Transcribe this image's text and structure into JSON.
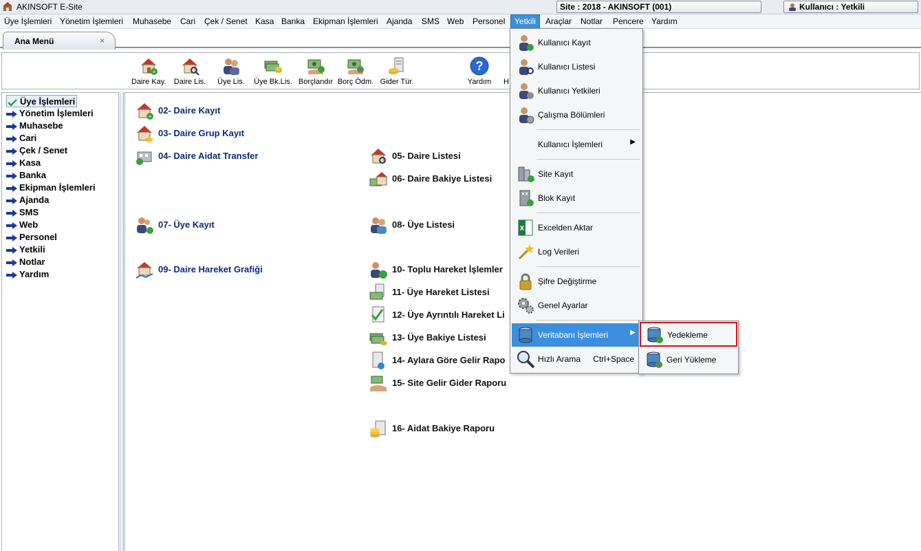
{
  "app": {
    "title": "AKINSOFT E-Site",
    "site_info": "Site : 2018 - AKINSOFT (001)",
    "user_info": "Kullanıcı : Yetkili"
  },
  "menubar": {
    "items": [
      "Üye İşlemleri",
      "Yönetim İşlemleri",
      "Muhasebe",
      "Cari",
      "Çek / Senet",
      "Kasa",
      "Banka",
      "Ekipman İşlemleri",
      "Ajanda",
      "SMS",
      "Web",
      "Personel",
      "Yetkili",
      "Araçlar",
      "Notlar",
      "Pencere",
      "Yardım"
    ],
    "active": "Yetkili"
  },
  "tab": {
    "label": "Ana Menü",
    "close": "×"
  },
  "toolbar": {
    "buttons": [
      "Daire Kay.",
      "Daire Lis.",
      "Üye Lis.",
      "Üye Bk.Lis.",
      "Borçlandır",
      "Borç Ödm.",
      "Gider Tür.",
      "Yardım",
      "H"
    ]
  },
  "sidebar": {
    "items": [
      "Üye İşlemleri",
      "Yönetim İşlemleri",
      "Muhasebe",
      "Cari",
      "Çek / Senet",
      "Kasa",
      "Banka",
      "Ekipman İşlemleri",
      "Ajanda",
      "SMS",
      "Web",
      "Personel",
      "Yetkili",
      "Notlar",
      "Yardım"
    ],
    "selected": "Üye İşlemleri"
  },
  "main": {
    "links": [
      "02- Daire Kayıt",
      "03- Daire Grup Kayıt",
      "04- Daire Aidat Transfer",
      "05- Daire Listesi",
      "06- Daire Bakiye Listesi",
      "07- Üye Kayıt",
      "08- Üye Listesi",
      "09- Daire Hareket Grafiği",
      "10- Toplu Hareket İşlemler",
      "11- Üye Hareket Listesi",
      "12- Üye Ayrıntılı Hareket Li",
      "13- Üye Bakiye Listesi",
      "14- Aylara Göre Gelir Rapo",
      "15- Site Gelir Gider Raporu",
      "16- Aidat Bakiye Raporu"
    ]
  },
  "dropdown": {
    "items": [
      {
        "label": "Kullanıcı Kayıt"
      },
      {
        "label": "Kullanıcı Listesi"
      },
      {
        "label": "Kullanıcı Yetkileri"
      },
      {
        "label": "Çalışma Bölümleri"
      },
      {
        "label": "Kullanıcı İşlemleri",
        "submenu": "▶"
      },
      {
        "label": "Site Kayıt"
      },
      {
        "label": "Blok Kayıt"
      },
      {
        "label": "Excelden Aktar"
      },
      {
        "label": "Log Verileri"
      },
      {
        "label": "Şifre Değiştirme"
      },
      {
        "label": "Genel Ayarlar"
      },
      {
        "label": "Veritabanı İşlemleri",
        "submenu": "▶"
      },
      {
        "label": "Hızlı Arama",
        "shortcut": "Ctrl+Space"
      }
    ],
    "submenu_items": [
      "Yedekleme",
      "Geri Yükleme"
    ],
    "highlighted": "Veritabanı İşlemleri",
    "emphasized_submenu_item": "Yedekleme"
  },
  "colors": {
    "accent": "#3b8fde",
    "link_blue": "#0d2a7a",
    "highlight_border": "#d0121b"
  }
}
